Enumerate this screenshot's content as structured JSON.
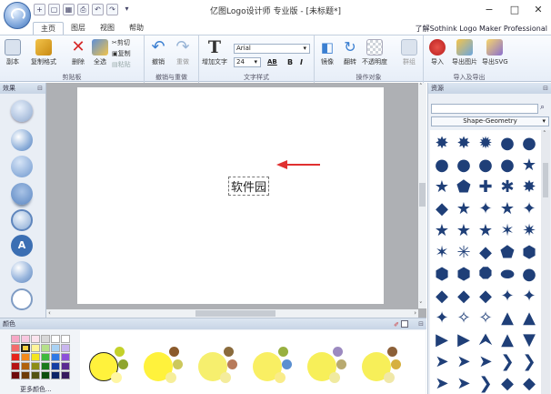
{
  "window": {
    "title": "亿图Logo设计师 专业版 - [未标题*]",
    "min": "−",
    "max": "□",
    "close": "✕"
  },
  "qat": [
    "+",
    "▢",
    "▦",
    "⎙",
    "↶",
    "↷",
    "▾"
  ],
  "tabs": [
    "主页",
    "图层",
    "视图",
    "帮助"
  ],
  "help_link": "了解Sothink Logo Maker Professional",
  "ribbon": {
    "clipboard": {
      "label": "剪贴板",
      "buttons": [
        "副本",
        "复制格式",
        "删除",
        "全选"
      ],
      "cut": "剪切",
      "copy": "复制",
      "paste": "粘贴"
    },
    "undo": {
      "label": "撤销与重做",
      "undo": "撤销",
      "redo": "重做"
    },
    "text": {
      "label": "文字样式",
      "add_text": "增加文字",
      "font": "Arial",
      "size": "24",
      "bold": "B",
      "italic": "I",
      "spacing": "AB"
    },
    "ops": {
      "label": "操作对象",
      "mirror": "镜像",
      "flip": "翻转",
      "opacity": "不透明度",
      "group": "群组"
    },
    "io": {
      "label": "导入及导出",
      "import": "导入",
      "export_img": "导出图片",
      "export_svg": "导出SVG"
    }
  },
  "panels": {
    "effects": "效果",
    "colors": "颜色",
    "resources": "资源",
    "pin": "⊟"
  },
  "canvas": {
    "text": "软件园"
  },
  "resources": {
    "category": "Shape-Geometry",
    "search_icon": "⌕"
  },
  "colors": {
    "more_label": "更多颜色...",
    "swatches": [
      "#f7a8c6",
      "#f9c8e0",
      "#fbe4ee",
      "#d8d8d8",
      "#ffffff",
      "#ffffff",
      "#f36b6b",
      "#f7d040",
      "#fff59a",
      "#b6e18a",
      "#a9d2f5",
      "#c9b6ef",
      "#e6261c",
      "#f28a1c",
      "#f4e51f",
      "#3fba3c",
      "#2f78e6",
      "#8d4fd9",
      "#b51414",
      "#b0620d",
      "#8c8c15",
      "#1b7a1b",
      "#153ea3",
      "#5a2a91",
      "#6e0a0a",
      "#6e3c08",
      "#535312",
      "#0d4e0d",
      "#0c2366",
      "#371a5e"
    ]
  },
  "color_combos": [
    {
      "main": "#fff23c",
      "small": [
        "#c4d12a",
        "#8ea52e",
        "#fff6a3"
      ]
    },
    {
      "main": "#fff23c",
      "small": [
        "#8b5a2b",
        "#ccc85c",
        "#f6ee9a"
      ]
    },
    {
      "main": "#f6ef6e",
      "small": [
        "#8a6b3c",
        "#b87a5a",
        "#f4ec9c"
      ]
    },
    {
      "main": "#f9ef63",
      "small": [
        "#98b040",
        "#5b8fd0",
        "#f9ec8a"
      ]
    },
    {
      "main": "#f7ef59",
      "small": [
        "#9c8ac0",
        "#b8aa70",
        "#f0eaa0"
      ]
    },
    {
      "main": "#f7ef59",
      "small": [
        "#8c6038",
        "#d6b040",
        "#f0e8a8"
      ]
    }
  ]
}
